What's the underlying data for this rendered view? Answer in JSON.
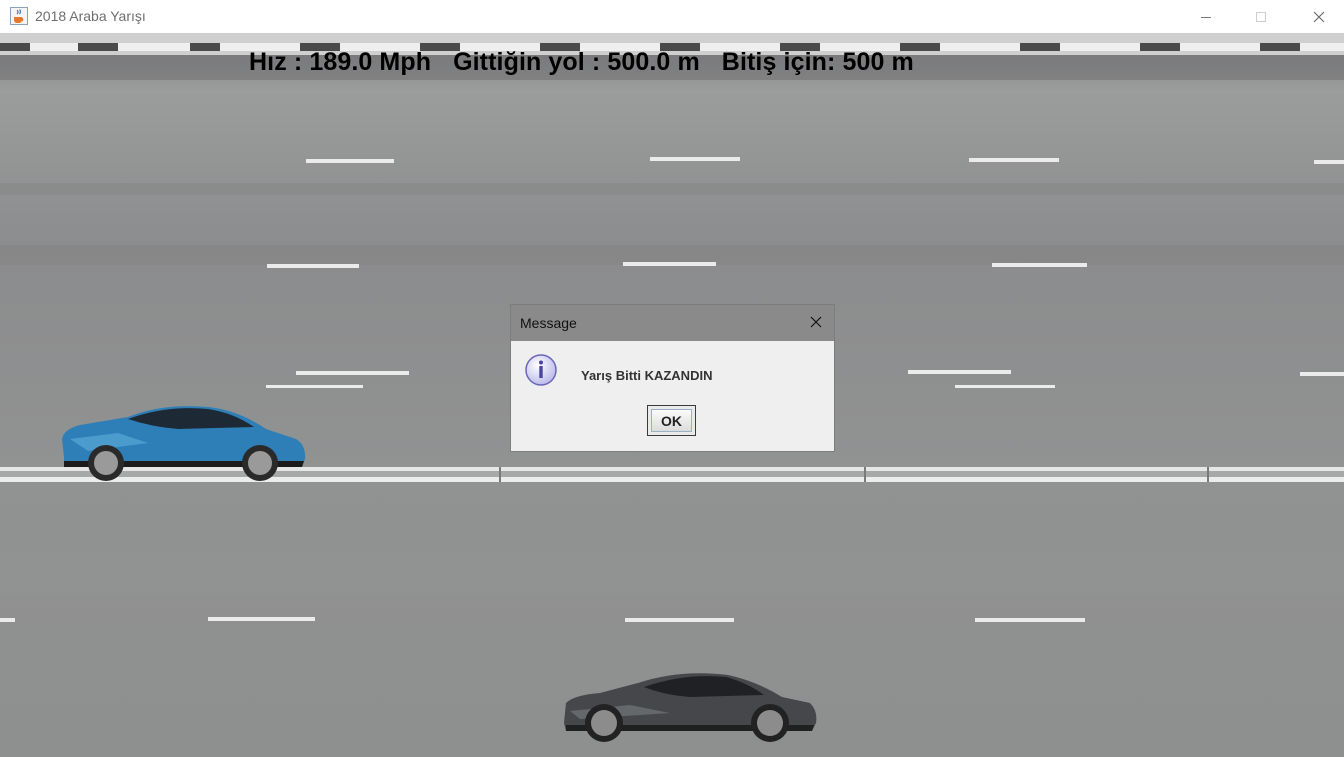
{
  "window": {
    "title": "2018 Araba Yarışı",
    "icon": "java-cup-icon"
  },
  "hud": {
    "speed": "Hız : 189.0 Mph",
    "distance": "Gittiğin yol : 500.0 m",
    "remaining": "Bitiş için: 500 m"
  },
  "cars": {
    "player": {
      "color": "#2e7fb8",
      "description": "blue-sports-car"
    },
    "opponent": {
      "color": "#3f4042",
      "description": "dark-gray-sports-car"
    }
  },
  "dialog": {
    "title": "Message",
    "message": "Yarış Bitti KAZANDIN",
    "ok_label": "OK",
    "icon": "info-icon"
  }
}
